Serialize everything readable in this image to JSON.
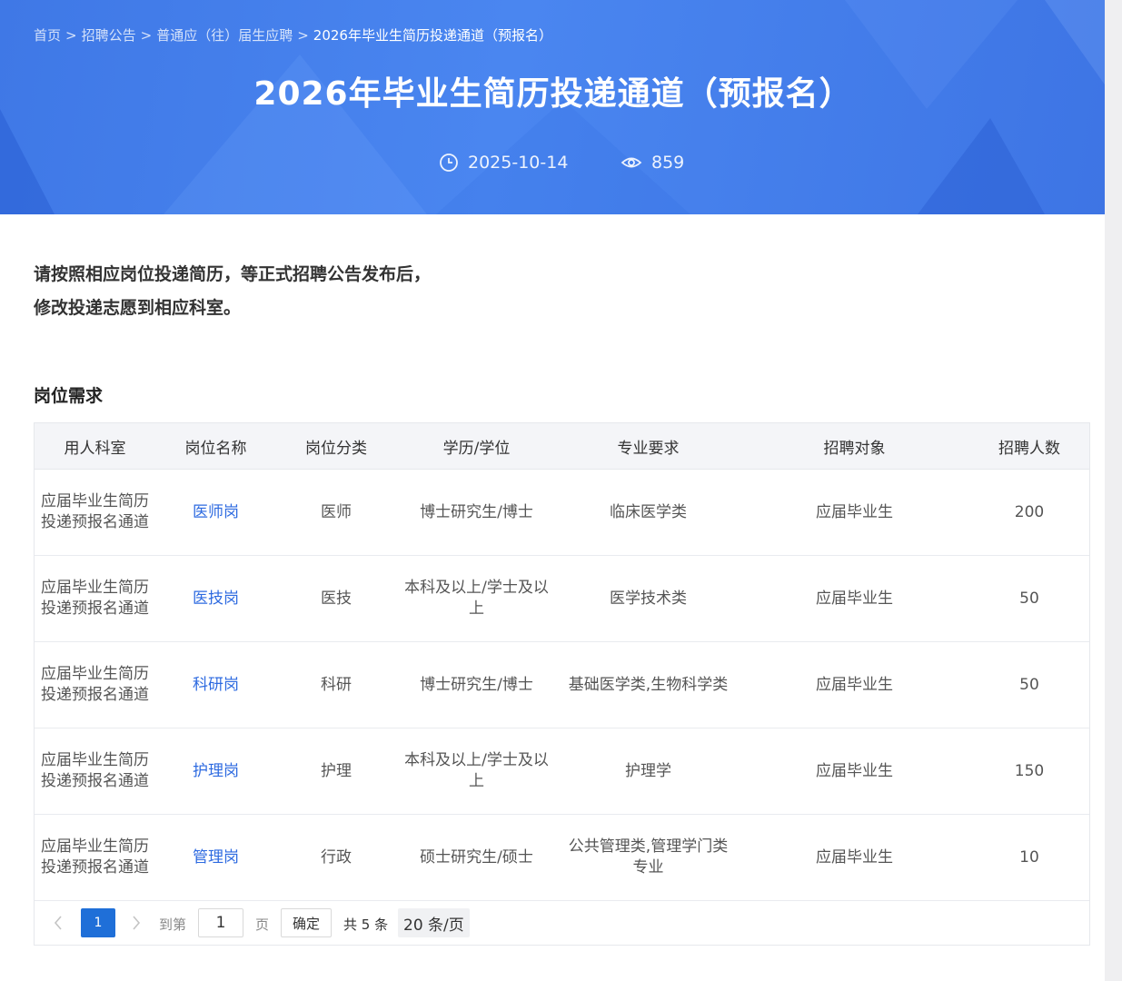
{
  "breadcrumb": {
    "items": [
      "首页",
      "招聘公告",
      "普通应（往）届生应聘"
    ],
    "current": "2026年毕业生简历投递通道（预报名）",
    "separator": ">"
  },
  "header": {
    "title": "2026年毕业生简历投递通道（预报名）",
    "date": "2025-10-14",
    "views": "859"
  },
  "notice": {
    "line1": "请按照相应岗位投递简历，等正式招聘公告发布后，",
    "line2": "修改投递志愿到相应科室。"
  },
  "section": {
    "title": "岗位需求"
  },
  "table": {
    "headers": [
      "用人科室",
      "岗位名称",
      "岗位分类",
      "学历/学位",
      "专业要求",
      "招聘对象",
      "招聘人数"
    ],
    "rows": [
      [
        "应届毕业生简历投递预报名通道",
        "医师岗",
        "医师",
        "博士研究生/博士",
        "临床医学类",
        "应届毕业生",
        "200"
      ],
      [
        "应届毕业生简历投递预报名通道",
        "医技岗",
        "医技",
        "本科及以上/学士及以上",
        "医学技术类",
        "应届毕业生",
        "50"
      ],
      [
        "应届毕业生简历投递预报名通道",
        "科研岗",
        "科研",
        "博士研究生/博士",
        "基础医学类,生物科学类",
        "应届毕业生",
        "50"
      ],
      [
        "应届毕业生简历投递预报名通道",
        "护理岗",
        "护理",
        "本科及以上/学士及以上",
        "护理学",
        "应届毕业生",
        "150"
      ],
      [
        "应届毕业生简历投递预报名通道",
        "管理岗",
        "行政",
        "硕士研究生/硕士",
        "公共管理类,管理学门类专业",
        "应届毕业生",
        "10"
      ]
    ]
  },
  "pagination": {
    "current": "1",
    "goto_label": "到第",
    "input_value": "1",
    "page_label": "页",
    "confirm_label": "确定",
    "total": "共 5 条",
    "page_size": "20 条/页"
  },
  "colors": {
    "banner": "#4a86f0",
    "link": "#2d6ae0",
    "pager_active": "#1f6fd8"
  }
}
